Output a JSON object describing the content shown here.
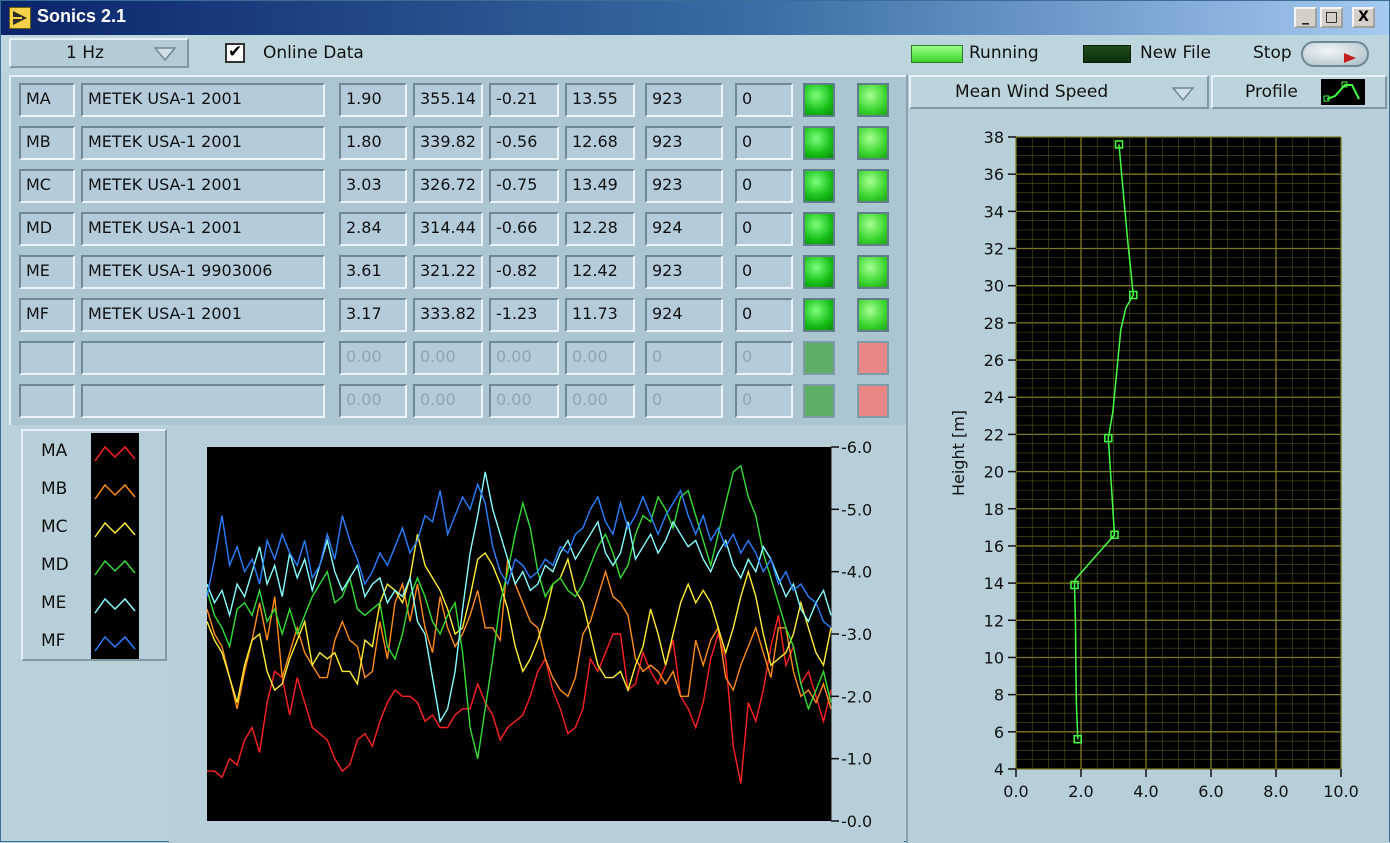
{
  "window": {
    "title": "Sonics 2.1",
    "min": "_",
    "max": "□",
    "close": "X"
  },
  "toolbar": {
    "rate": "1 Hz",
    "online_label": "Online Data",
    "online_checked": "✔",
    "running_label": "Running",
    "newfile_label": "New File",
    "stop_label": "Stop"
  },
  "table": {
    "rows": [
      {
        "id": "MA",
        "name": "METEK USA-1 2001",
        "v1": "1.90",
        "v2": "355.14",
        "v3": "-0.21",
        "v4": "13.55",
        "v5": "923",
        "v6": "0"
      },
      {
        "id": "MB",
        "name": "METEK USA-1 2001",
        "v1": "1.80",
        "v2": "339.82",
        "v3": "-0.56",
        "v4": "12.68",
        "v5": "923",
        "v6": "0"
      },
      {
        "id": "MC",
        "name": "METEK USA-1 2001",
        "v1": "3.03",
        "v2": "326.72",
        "v3": "-0.75",
        "v4": "13.49",
        "v5": "923",
        "v6": "0"
      },
      {
        "id": "MD",
        "name": "METEK USA-1 2001",
        "v1": "2.84",
        "v2": "314.44",
        "v3": "-0.66",
        "v4": "12.28",
        "v5": "924",
        "v6": "0"
      },
      {
        "id": "ME",
        "name": "METEK USA-1 9903006",
        "v1": "3.61",
        "v2": "321.22",
        "v3": "-0.82",
        "v4": "12.42",
        "v5": "923",
        "v6": "0"
      },
      {
        "id": "MF",
        "name": "METEK USA-1 2001",
        "v1": "3.17",
        "v2": "333.82",
        "v3": "-1.23",
        "v4": "11.73",
        "v5": "924",
        "v6": "0"
      },
      {
        "id": "",
        "name": "",
        "v1": "0.00",
        "v2": "0.00",
        "v3": "0.00",
        "v4": "0.00",
        "v5": "0",
        "v6": "0"
      },
      {
        "id": "",
        "name": "",
        "v1": "0.00",
        "v2": "0.00",
        "v3": "0.00",
        "v4": "0.00",
        "v5": "0",
        "v6": "0"
      }
    ]
  },
  "legend": {
    "items": [
      {
        "name": "MA",
        "color": "#ff2222"
      },
      {
        "name": "MB",
        "color": "#ff8c1a"
      },
      {
        "name": "MC",
        "color": "#ffee33"
      },
      {
        "name": "MD",
        "color": "#33dd33"
      },
      {
        "name": "ME",
        "color": "#88ffff"
      },
      {
        "name": "MF",
        "color": "#2a7fff"
      }
    ]
  },
  "profile_header": {
    "selector": "Mean Wind Speed",
    "button": "Profile"
  },
  "chart_data": [
    {
      "type": "line",
      "y_ticks": [
        "-6.0",
        "-5.0",
        "-4.0",
        "-3.0",
        "-2.0",
        "-1.0",
        "-0.0"
      ],
      "ylim": [
        0,
        6
      ],
      "background": "#000000",
      "series": [
        {
          "name": "MA",
          "color": "#ff2222",
          "values": [
            0.8,
            0.8,
            0.7,
            1.0,
            0.9,
            1.3,
            1.5,
            1.1,
            1.9,
            2.4,
            2.3,
            1.7,
            2.3,
            1.9,
            1.5,
            1.4,
            1.3,
            1.0,
            0.8,
            0.9,
            1.3,
            1.4,
            1.2,
            1.6,
            1.9,
            2.1,
            2.0,
            2.0,
            1.9,
            1.6,
            1.7,
            1.5,
            1.5,
            1.7,
            1.8,
            1.8,
            2.2,
            1.9,
            1.7,
            1.3,
            1.5,
            1.6,
            1.7,
            2.0,
            2.4,
            2.6,
            2.1,
            1.8,
            1.4,
            1.5,
            1.8,
            2.6,
            2.4,
            2.7,
            3.0,
            3.0,
            2.1,
            2.2,
            2.7,
            2.4,
            2.2,
            2.5,
            2.9,
            2.0,
            1.8,
            1.5,
            1.9,
            2.6,
            3.0,
            2.6,
            1.2,
            0.6,
            1.9,
            1.6,
            2.1,
            2.8,
            3.3,
            2.5,
            2.8,
            2.2,
            2.4,
            2.0,
            1.6,
            2.1
          ]
        },
        {
          "name": "MB",
          "color": "#ff8c1a",
          "values": [
            3.4,
            3.0,
            2.8,
            2.3,
            1.8,
            2.4,
            2.9,
            3.5,
            2.9,
            3.6,
            2.3,
            2.7,
            3.1,
            2.7,
            2.5,
            2.3,
            2.3,
            2.9,
            3.2,
            2.9,
            2.8,
            2.3,
            2.4,
            3.2,
            2.6,
            3.5,
            3.8,
            3.2,
            3.8,
            3.1,
            2.7,
            3.6,
            3.1,
            2.8,
            3.0,
            3.3,
            3.7,
            3.1,
            3.1,
            2.9,
            4.2,
            3.8,
            3.5,
            3.2,
            3.1,
            2.6,
            2.3,
            2.1,
            2.0,
            2.3,
            3.0,
            3.2,
            3.6,
            4.0,
            3.6,
            3.5,
            3.3,
            2.6,
            2.4,
            2.5,
            2.4,
            2.2,
            2.4,
            2.0,
            2.0,
            2.9,
            2.5,
            2.9,
            3.1,
            2.3,
            2.1,
            2.5,
            2.8,
            3.1,
            2.7,
            2.3,
            3.1,
            3.1,
            2.4,
            2.0,
            2.1,
            1.9,
            2.2,
            1.8
          ]
        },
        {
          "name": "MC",
          "color": "#ffee33",
          "values": [
            3.2,
            2.9,
            2.7,
            2.3,
            1.9,
            2.5,
            2.9,
            3.0,
            2.4,
            2.1,
            2.2,
            2.6,
            2.9,
            3.2,
            2.5,
            2.7,
            2.6,
            2.7,
            2.4,
            2.4,
            2.2,
            2.9,
            2.8,
            3.5,
            3.8,
            3.7,
            3.5,
            3.9,
            4.6,
            4.1,
            3.9,
            3.7,
            3.4,
            3.0,
            3.1,
            3.6,
            4.2,
            4.3,
            4.1,
            3.8,
            3.4,
            2.8,
            2.4,
            2.6,
            2.9,
            3.3,
            3.8,
            3.9,
            4.2,
            3.7,
            3.5,
            3.0,
            2.5,
            2.3,
            2.3,
            2.4,
            2.1,
            2.5,
            2.8,
            3.4,
            3.0,
            2.5,
            3.0,
            3.5,
            3.8,
            3.5,
            3.7,
            3.5,
            3.1,
            2.7,
            3.1,
            3.6,
            4.0,
            3.6,
            3.0,
            2.5,
            2.6,
            2.7,
            3.0,
            3.5,
            3.1,
            2.7,
            2.5,
            3.1
          ]
        },
        {
          "name": "MD",
          "color": "#33dd33",
          "values": [
            3.7,
            3.3,
            3.1,
            2.8,
            3.4,
            3.5,
            3.3,
            3.7,
            3.2,
            3.4,
            3.0,
            3.4,
            3.0,
            3.3,
            3.6,
            3.8,
            4.0,
            3.5,
            3.6,
            3.9,
            3.4,
            3.3,
            3.4,
            3.5,
            2.8,
            2.6,
            3.0,
            3.6,
            3.9,
            3.6,
            3.2,
            3.0,
            3.3,
            3.5,
            2.7,
            1.5,
            1.0,
            1.8,
            2.6,
            3.5,
            4.0,
            4.6,
            5.1,
            4.7,
            4.0,
            3.6,
            3.8,
            3.9,
            3.7,
            3.6,
            3.8,
            4.1,
            4.4,
            4.6,
            4.3,
            3.9,
            4.1,
            4.6,
            4.9,
            4.8,
            5.2,
            5.0,
            4.7,
            5.2,
            5.3,
            4.9,
            4.5,
            4.1,
            4.6,
            5.1,
            5.6,
            5.7,
            5.2,
            4.9,
            4.3,
            3.9,
            3.5,
            3.1,
            2.8,
            2.2,
            1.8,
            2.1,
            2.4,
            1.9
          ]
        },
        {
          "name": "ME",
          "color": "#88ffff",
          "values": [
            3.8,
            3.5,
            3.7,
            3.3,
            3.8,
            3.6,
            4.0,
            4.4,
            3.8,
            4.1,
            3.6,
            4.3,
            3.9,
            4.2,
            3.7,
            4.1,
            4.5,
            4.0,
            3.7,
            3.9,
            4.1,
            3.6,
            3.8,
            3.9,
            3.5,
            3.7,
            3.6,
            3.9,
            3.2,
            3.0,
            2.3,
            1.6,
            1.8,
            2.4,
            3.4,
            4.3,
            4.9,
            5.6,
            5.0,
            4.6,
            4.2,
            3.8,
            4.0,
            3.7,
            3.8,
            4.1,
            4.0,
            4.3,
            4.5,
            4.2,
            4.4,
            4.6,
            4.8,
            4.3,
            4.1,
            4.3,
            4.8,
            4.2,
            4.4,
            4.6,
            4.3,
            4.5,
            4.8,
            4.6,
            4.4,
            4.5,
            4.2,
            4.0,
            4.3,
            4.5,
            4.1,
            3.9,
            4.2,
            4.0,
            4.4,
            4.2,
            3.9,
            3.6,
            3.8,
            3.4,
            3.2,
            3.5,
            3.7,
            3.3
          ]
        },
        {
          "name": "MF",
          "color": "#2a7fff",
          "values": [
            3.6,
            4.2,
            4.9,
            4.1,
            4.4,
            4.0,
            4.2,
            3.8,
            4.5,
            4.2,
            4.6,
            4.3,
            4.1,
            4.5,
            3.9,
            4.1,
            4.6,
            4.2,
            4.9,
            4.5,
            4.2,
            3.8,
            4.0,
            4.3,
            4.1,
            4.4,
            4.7,
            4.3,
            4.5,
            4.9,
            4.8,
            5.3,
            4.6,
            4.9,
            5.2,
            5.0,
            5.4,
            5.1,
            4.4,
            4.0,
            3.8,
            4.2,
            4.1,
            3.9,
            4.0,
            4.2,
            4.1,
            4.4,
            4.3,
            4.6,
            4.7,
            5.0,
            5.2,
            4.8,
            4.6,
            5.1,
            4.7,
            4.9,
            5.2,
            4.9,
            4.6,
            4.9,
            5.1,
            5.3,
            4.9,
            4.6,
            4.9,
            4.5,
            4.7,
            4.4,
            4.6,
            4.3,
            4.5,
            4.3,
            4.0,
            4.2,
            3.8,
            4.0,
            3.7,
            3.8,
            3.6,
            3.5,
            3.2,
            3.1
          ]
        }
      ]
    },
    {
      "type": "line",
      "ylabel": "Height [m]",
      "xlim": [
        0,
        10
      ],
      "ylim": [
        4,
        38
      ],
      "x_ticks": [
        "0.0",
        "2.0",
        "4.0",
        "6.0",
        "8.0",
        "10.0"
      ],
      "y_ticks": [
        "4",
        "6",
        "8",
        "10",
        "12",
        "14",
        "16",
        "18",
        "20",
        "22",
        "24",
        "26",
        "28",
        "30",
        "32",
        "34",
        "36",
        "38"
      ],
      "grid": true,
      "background": "#000000",
      "line_color": "#44ff44",
      "points": [
        {
          "x": 1.9,
          "y": 5.6
        },
        {
          "x": 1.8,
          "y": 13.9
        },
        {
          "x": 3.03,
          "y": 16.6
        },
        {
          "x": 2.84,
          "y": 21.8
        },
        {
          "x": 3.61,
          "y": 29.5
        },
        {
          "x": 3.17,
          "y": 37.6
        }
      ],
      "line_x": [
        1.9,
        1.86,
        1.84,
        1.83,
        1.8,
        1.82,
        3.03,
        2.93,
        2.84,
        2.98,
        3.1,
        3.22,
        3.38,
        3.61,
        3.45,
        3.3,
        3.17
      ],
      "line_y": [
        5.6,
        7.5,
        9.8,
        11.8,
        13.9,
        14.2,
        16.6,
        19.4,
        21.8,
        23.2,
        25.4,
        27.6,
        28.8,
        29.5,
        32.2,
        35.0,
        37.6
      ]
    }
  ]
}
